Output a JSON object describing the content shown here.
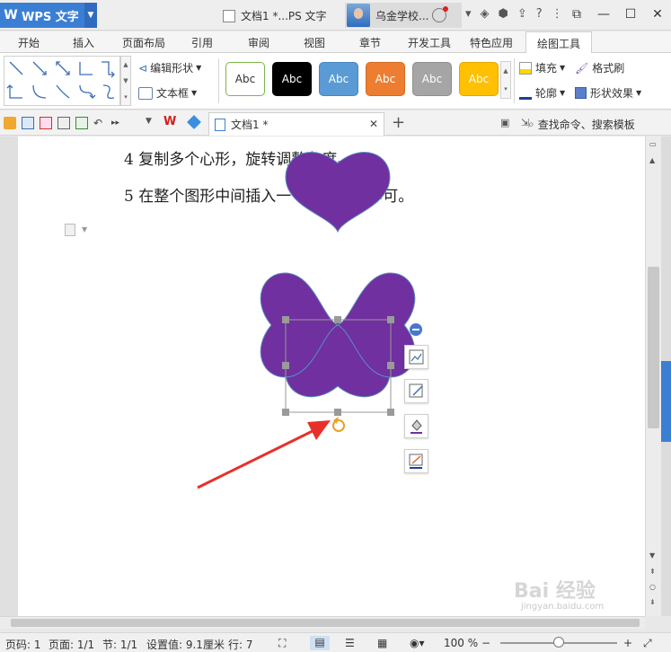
{
  "app": {
    "name": "WPS 文字",
    "doc_title": "文档1 *...PS 文字",
    "user_name": "乌金学校..."
  },
  "tabs": [
    "开始",
    "插入",
    "页面布局",
    "引用",
    "审阅",
    "视图",
    "章节",
    "开发工具",
    "特色应用",
    "绘图工具"
  ],
  "active_tab": "绘图工具",
  "ribbon": {
    "edit_shape": "编辑形状",
    "text_box": "文本框",
    "styles": [
      {
        "label": "Abc",
        "bg": "#ffffff",
        "fg": "#333333",
        "border": "#7ab648"
      },
      {
        "label": "Abc",
        "bg": "#000000",
        "fg": "#ffffff",
        "border": "#000000"
      },
      {
        "label": "Abc",
        "bg": "#5b9bd5",
        "fg": "#ffffff",
        "border": "#4a86be"
      },
      {
        "label": "Abc",
        "bg": "#ed7d31",
        "fg": "#ffffff",
        "border": "#d36a22"
      },
      {
        "label": "Abc",
        "bg": "#a5a5a5",
        "fg": "#ffffff",
        "border": "#8f8f8f"
      },
      {
        "label": "Abc",
        "bg": "#ffc000",
        "fg": "#ffffff",
        "border": "#e0a800"
      }
    ],
    "fill": "填充",
    "format_brush": "格式刷",
    "outline": "轮廓",
    "shape_effects": "形状效果"
  },
  "doc_tab": {
    "label": "文档1 *"
  },
  "search_cmd": "查找命令、搜索模板",
  "document": {
    "line1": "4 复制多个心形，旋转调整角度。",
    "line2": "5 在整个图形中间插入一个太阳形状即可。"
  },
  "shape_color": "#7030a0",
  "arrow_color": "#e8302a",
  "status": {
    "page_no": "页码: 1",
    "pages": "页面: 1/1",
    "section": "节: 1/1",
    "setting": "设置值: 9.1厘米",
    "row": "行: 7",
    "zoom": "100 %"
  },
  "watermark": {
    "brand": "Bai 经验",
    "url": "jingyan.baidu.com"
  }
}
